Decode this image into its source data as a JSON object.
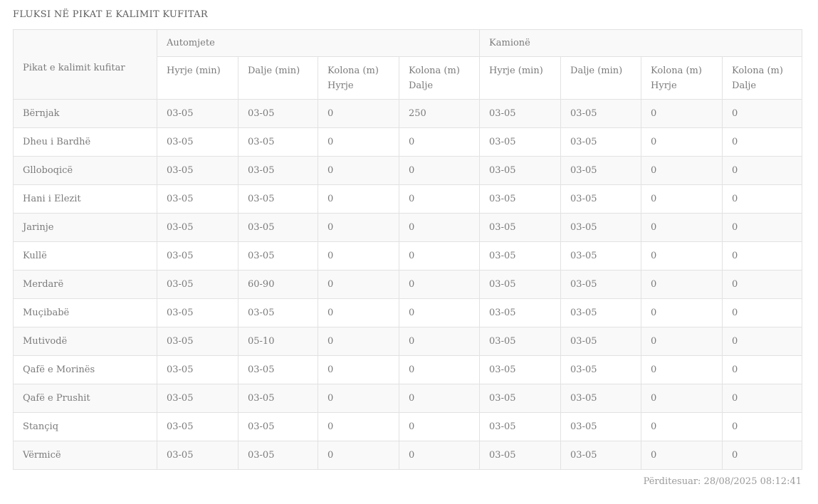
{
  "page": {
    "title": "FLUKSI NË PIKAT E KALIMIT KUFITAR",
    "updated": "Përditesuar: 28/08/2025 08:12:41"
  },
  "colors": {
    "stripe": "#f9f9f9",
    "border": "#e2e2e2",
    "text": "#7b7b7b",
    "title_text": "#5d5d5d",
    "footer_text": "#9a9a9a"
  },
  "table": {
    "col1_header": "Pikat e kalimit kufitar",
    "groups": [
      {
        "label": "Automjete"
      },
      {
        "label": "Kamionë"
      }
    ],
    "sub_headers": [
      "Hyrje (min)",
      "Dalje (min)",
      "Kolona (m) Hyrje",
      "Kolona (m) Dalje",
      "Hyrje (min)",
      "Dalje (min)",
      "Kolona (m) Hyrje",
      "Kolona (m) Dalje"
    ],
    "rows": [
      {
        "name": "Bërnjak",
        "values": [
          "03-05",
          "03-05",
          "0",
          "250",
          "03-05",
          "03-05",
          "0",
          "0"
        ]
      },
      {
        "name": "Dheu i Bardhë",
        "values": [
          "03-05",
          "03-05",
          "0",
          "0",
          "03-05",
          "03-05",
          "0",
          "0"
        ]
      },
      {
        "name": "Glloboqicë",
        "values": [
          "03-05",
          "03-05",
          "0",
          "0",
          "03-05",
          "03-05",
          "0",
          "0"
        ]
      },
      {
        "name": "Hani i Elezit",
        "values": [
          "03-05",
          "03-05",
          "0",
          "0",
          "03-05",
          "03-05",
          "0",
          "0"
        ]
      },
      {
        "name": "Jarinje",
        "values": [
          "03-05",
          "03-05",
          "0",
          "0",
          "03-05",
          "03-05",
          "0",
          "0"
        ]
      },
      {
        "name": "Kullë",
        "values": [
          "03-05",
          "03-05",
          "0",
          "0",
          "03-05",
          "03-05",
          "0",
          "0"
        ]
      },
      {
        "name": "Merdarë",
        "values": [
          "03-05",
          "60-90",
          "0",
          "0",
          "03-05",
          "03-05",
          "0",
          "0"
        ]
      },
      {
        "name": "Muçibabë",
        "values": [
          "03-05",
          "03-05",
          "0",
          "0",
          "03-05",
          "03-05",
          "0",
          "0"
        ]
      },
      {
        "name": "Mutivodë",
        "values": [
          "03-05",
          "05-10",
          "0",
          "0",
          "03-05",
          "03-05",
          "0",
          "0"
        ]
      },
      {
        "name": "Qafë e Morinës",
        "values": [
          "03-05",
          "03-05",
          "0",
          "0",
          "03-05",
          "03-05",
          "0",
          "0"
        ]
      },
      {
        "name": "Qafë e Prushit",
        "values": [
          "03-05",
          "03-05",
          "0",
          "0",
          "03-05",
          "03-05",
          "0",
          "0"
        ]
      },
      {
        "name": "Stançiq",
        "values": [
          "03-05",
          "03-05",
          "0",
          "0",
          "03-05",
          "03-05",
          "0",
          "0"
        ]
      },
      {
        "name": "Vërmicë",
        "values": [
          "03-05",
          "03-05",
          "0",
          "0",
          "03-05",
          "03-05",
          "0",
          "0"
        ]
      }
    ]
  }
}
